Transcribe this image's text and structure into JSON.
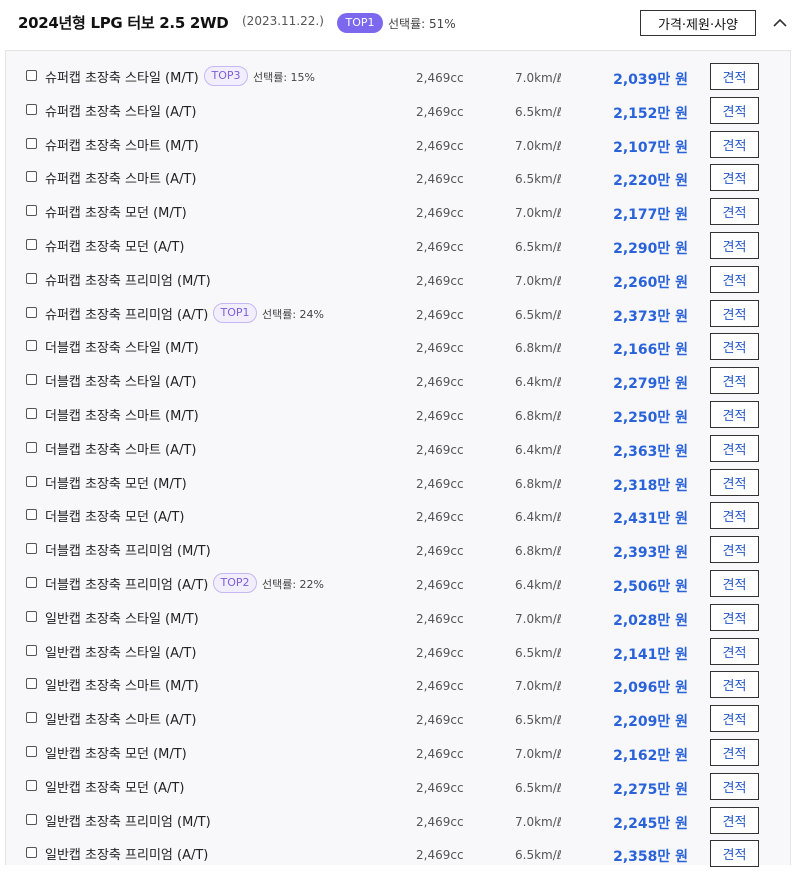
{
  "header": {
    "title": "2024년형 LPG 터보 2.5 2WD",
    "date": "(2023.11.22.)",
    "badge": "TOP1",
    "selection_rate": "선택률: 51%",
    "spec_button": "가격·제원·사양"
  },
  "trims": [
    {
      "name": "슈퍼캡 초장축 스타일 (M/T)",
      "badge": "TOP3",
      "rate": "선택률: 15%",
      "cc": "2,469cc",
      "efficiency": "7.0km/ℓ",
      "price": "2,039만 원",
      "quote": "견적"
    },
    {
      "name": "슈퍼캡 초장축 스타일 (A/T)",
      "cc": "2,469cc",
      "efficiency": "6.5km/ℓ",
      "price": "2,152만 원",
      "quote": "견적"
    },
    {
      "name": "슈퍼캡 초장축 스마트 (M/T)",
      "cc": "2,469cc",
      "efficiency": "7.0km/ℓ",
      "price": "2,107만 원",
      "quote": "견적"
    },
    {
      "name": "슈퍼캡 초장축 스마트 (A/T)",
      "cc": "2,469cc",
      "efficiency": "6.5km/ℓ",
      "price": "2,220만 원",
      "quote": "견적"
    },
    {
      "name": "슈퍼캡 초장축 모던 (M/T)",
      "cc": "2,469cc",
      "efficiency": "7.0km/ℓ",
      "price": "2,177만 원",
      "quote": "견적"
    },
    {
      "name": "슈퍼캡 초장축 모던 (A/T)",
      "cc": "2,469cc",
      "efficiency": "6.5km/ℓ",
      "price": "2,290만 원",
      "quote": "견적"
    },
    {
      "name": "슈퍼캡 초장축 프리미엄 (M/T)",
      "cc": "2,469cc",
      "efficiency": "7.0km/ℓ",
      "price": "2,260만 원",
      "quote": "견적"
    },
    {
      "name": "슈퍼캡 초장축 프리미엄 (A/T)",
      "badge": "TOP1",
      "rate": "선택률: 24%",
      "cc": "2,469cc",
      "efficiency": "6.5km/ℓ",
      "price": "2,373만 원",
      "quote": "견적"
    },
    {
      "name": "더블캡 초장축 스타일 (M/T)",
      "cc": "2,469cc",
      "efficiency": "6.8km/ℓ",
      "price": "2,166만 원",
      "quote": "견적"
    },
    {
      "name": "더블캡 초장축 스타일 (A/T)",
      "cc": "2,469cc",
      "efficiency": "6.4km/ℓ",
      "price": "2,279만 원",
      "quote": "견적"
    },
    {
      "name": "더블캡 초장축 스마트 (M/T)",
      "cc": "2,469cc",
      "efficiency": "6.8km/ℓ",
      "price": "2,250만 원",
      "quote": "견적"
    },
    {
      "name": "더블캡 초장축 스마트 (A/T)",
      "cc": "2,469cc",
      "efficiency": "6.4km/ℓ",
      "price": "2,363만 원",
      "quote": "견적"
    },
    {
      "name": "더블캡 초장축 모던 (M/T)",
      "cc": "2,469cc",
      "efficiency": "6.8km/ℓ",
      "price": "2,318만 원",
      "quote": "견적"
    },
    {
      "name": "더블캡 초장축 모던 (A/T)",
      "cc": "2,469cc",
      "efficiency": "6.4km/ℓ",
      "price": "2,431만 원",
      "quote": "견적"
    },
    {
      "name": "더블캡 초장축 프리미엄 (M/T)",
      "cc": "2,469cc",
      "efficiency": "6.8km/ℓ",
      "price": "2,393만 원",
      "quote": "견적"
    },
    {
      "name": "더블캡 초장축 프리미엄 (A/T)",
      "badge": "TOP2",
      "rate": "선택률: 22%",
      "cc": "2,469cc",
      "efficiency": "6.4km/ℓ",
      "price": "2,506만 원",
      "quote": "견적"
    },
    {
      "name": "일반캡 초장축 스타일 (M/T)",
      "cc": "2,469cc",
      "efficiency": "7.0km/ℓ",
      "price": "2,028만 원",
      "quote": "견적"
    },
    {
      "name": "일반캡 초장축 스타일 (A/T)",
      "cc": "2,469cc",
      "efficiency": "6.5km/ℓ",
      "price": "2,141만 원",
      "quote": "견적"
    },
    {
      "name": "일반캡 초장축 스마트 (M/T)",
      "cc": "2,469cc",
      "efficiency": "7.0km/ℓ",
      "price": "2,096만 원",
      "quote": "견적"
    },
    {
      "name": "일반캡 초장축 스마트 (A/T)",
      "cc": "2,469cc",
      "efficiency": "6.5km/ℓ",
      "price": "2,209만 원",
      "quote": "견적"
    },
    {
      "name": "일반캡 초장축 모던 (M/T)",
      "cc": "2,469cc",
      "efficiency": "7.0km/ℓ",
      "price": "2,162만 원",
      "quote": "견적"
    },
    {
      "name": "일반캡 초장축 모던 (A/T)",
      "cc": "2,469cc",
      "efficiency": "6.5km/ℓ",
      "price": "2,275만 원",
      "quote": "견적"
    },
    {
      "name": "일반캡 초장축 프리미엄 (M/T)",
      "cc": "2,469cc",
      "efficiency": "7.0km/ℓ",
      "price": "2,245만 원",
      "quote": "견적"
    },
    {
      "name": "일반캡 초장축 프리미엄 (A/T)",
      "cc": "2,469cc",
      "efficiency": "6.5km/ℓ",
      "price": "2,358만 원",
      "quote": "견적"
    }
  ],
  "icons": {
    "collapse": "chevron-up-icon",
    "checkbox": "checkbox-icon"
  },
  "colors": {
    "accent": "#7b68ee",
    "price": "#2962d9",
    "list_background": "#f8f8fa"
  }
}
